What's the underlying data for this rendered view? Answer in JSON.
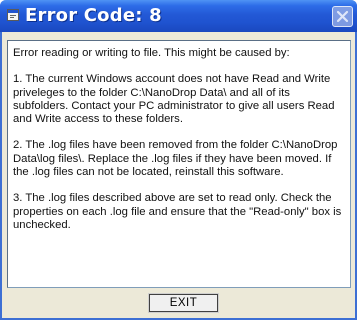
{
  "dialog": {
    "title": "Error Code: 8",
    "title_icon": "app-icon",
    "close_icon": "close-icon",
    "message": [
      "Error reading or writing to file.  This might be caused by:",
      "1. The current Windows account does not have Read and Write priveleges to the folder C:\\NanoDrop Data\\ and all of its subfolders.  Contact your PC administrator to give all users Read and Write access to these folders.",
      "2. The .log files have been removed from the folder C:\\NanoDrop Data\\log files\\.  Replace the .log files if they have been moved.  If the .log files can not be located, reinstall this software.",
      "3. The .log files described above are set to read only.  Check the properties on each .log file and ensure that the \"Read-only\" box is unchecked."
    ],
    "exit_label": "EXIT"
  },
  "colors": {
    "titlebar": "#2359d6",
    "window_bg": "#ece9d8",
    "border": "#3d6fd4"
  }
}
